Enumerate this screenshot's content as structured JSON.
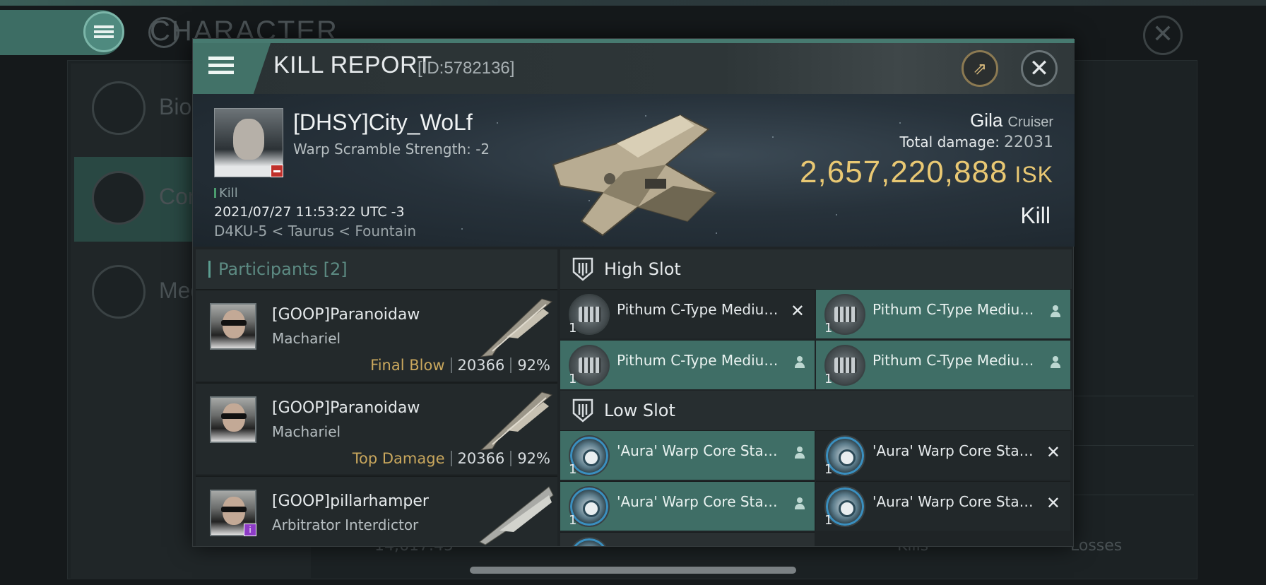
{
  "background": {
    "title": "CHARACTER",
    "side_items": [
      "Bio",
      "Com",
      "Med"
    ],
    "bottom_value": "14,617.45",
    "bottom_labels": [
      "Kills",
      "Losses"
    ]
  },
  "window": {
    "title": "KILL REPORT",
    "id": "[ID:5782136]"
  },
  "victim": {
    "name": "[DHSY]City_WoLf",
    "subtitle": "Warp Scramble Strength: -2",
    "tag": "Kill",
    "date": "2021/07/27 11:53:22 UTC -3",
    "location": "D4KU-5 < Taurus < Fountain",
    "ship": "Gila",
    "ship_class": "Cruiser",
    "total_damage_label": "Total damage:",
    "total_damage": "22031",
    "isk_value": "2,657,220,888",
    "isk_unit": "ISK",
    "kill_type": "Kill"
  },
  "participants": {
    "label": "Participants",
    "count": "[2]",
    "rows": [
      {
        "name": "[GOOP]Paranoidaw",
        "ship": "Machariel",
        "role": "Final Blow",
        "damage": "20366",
        "percent": "92%"
      },
      {
        "name": "[GOOP]Paranoidaw",
        "ship": "Machariel",
        "role": "Top Damage",
        "damage": "20366",
        "percent": "92%"
      },
      {
        "name": "[GOOP]pillarhamper",
        "ship": "Arbitrator Interdictor"
      }
    ]
  },
  "slots": {
    "high_label": "High Slot",
    "low_label": "Low Slot",
    "high": [
      {
        "name": "Pithum C-Type Medium...",
        "qty": "1",
        "status": "destroyed"
      },
      {
        "name": "Pithum C-Type Medium...",
        "qty": "1",
        "status": "dropped"
      },
      {
        "name": "Pithum C-Type Medium...",
        "qty": "1",
        "status": "dropped"
      },
      {
        "name": "Pithum C-Type Medium...",
        "qty": "1",
        "status": "dropped"
      }
    ],
    "low": [
      {
        "name": "'Aura' Warp Core Stabilizer",
        "qty": "1",
        "status": "dropped"
      },
      {
        "name": "'Aura' Warp Core Stabilizer",
        "qty": "1",
        "status": "destroyed"
      },
      {
        "name": "'Aura' Warp Core Stabilizer",
        "qty": "1",
        "status": "dropped"
      },
      {
        "name": "'Aura' Warp Core Stabilizer",
        "qty": "1",
        "status": "destroyed"
      }
    ]
  }
}
